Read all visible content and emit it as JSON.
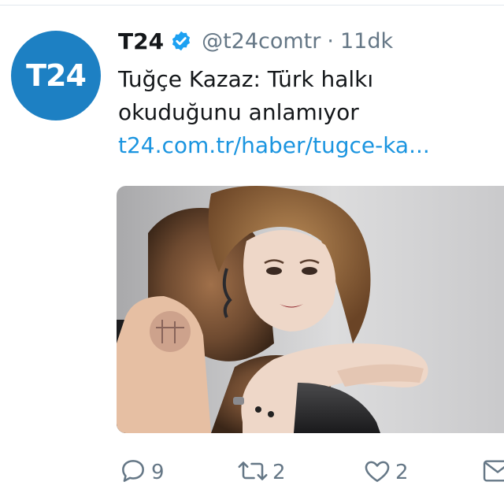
{
  "tweet": {
    "avatar_text": "T24",
    "display_name": "T24",
    "handle": "@t24comtr",
    "separator": "·",
    "time": "11dk",
    "text": "Tuğçe Kazaz: Türk halkı okuduğunu anlamıyor",
    "link": "t24.com.tr/haber/tugce-ka...",
    "reply_count": "9",
    "retweet_count": "2",
    "like_count": "2",
    "icons": {
      "verified": "verified-badge-icon",
      "reply": "reply-icon",
      "retweet": "retweet-icon",
      "like": "heart-icon",
      "dm": "envelope-icon"
    }
  },
  "colors": {
    "brand_blue": "#1d80c3",
    "link_blue": "#1b95e0",
    "muted_gray": "#657786",
    "text": "#14171a"
  }
}
